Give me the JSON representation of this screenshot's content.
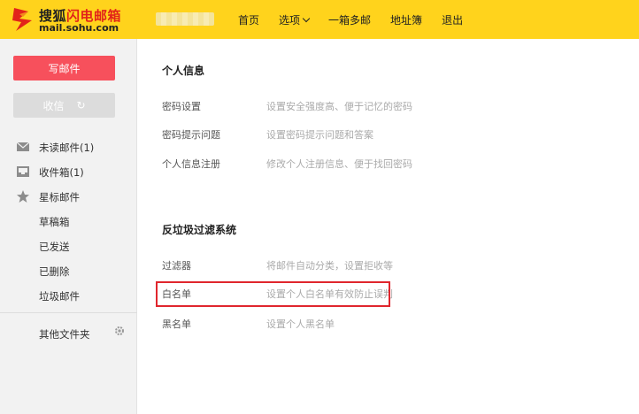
{
  "header": {
    "logo_title_prefix": "搜狐",
    "logo_title_suffix": "闪电邮箱",
    "logo_subtitle": "mail.sohu.com",
    "nav": [
      {
        "label": "首页"
      },
      {
        "label": "选项"
      },
      {
        "label": "一箱多邮"
      },
      {
        "label": "地址簿"
      },
      {
        "label": "退出"
      }
    ]
  },
  "sidebar": {
    "compose_label": "写邮件",
    "receive_label": "收信",
    "folders": [
      {
        "label": "未读邮件(1)",
        "icon": "mail-icon"
      },
      {
        "label": "收件箱(1)",
        "icon": "inbox-icon"
      },
      {
        "label": "星标邮件",
        "icon": "star-icon"
      },
      {
        "label": "草稿箱"
      },
      {
        "label": "已发送"
      },
      {
        "label": "已删除"
      },
      {
        "label": "垃圾邮件"
      }
    ],
    "other_folders_label": "其他文件夹"
  },
  "main": {
    "personal": {
      "title": "个人信息",
      "rows": [
        {
          "label": "密码设置",
          "desc": "设置安全强度高、便于记忆的密码"
        },
        {
          "label": "密码提示问题",
          "desc": "设置密码提示问题和答案"
        },
        {
          "label": "个人信息注册",
          "desc": "修改个人注册信息、便于找回密码"
        }
      ]
    },
    "spam": {
      "title": "反垃圾过滤系统",
      "rows": [
        {
          "label": "过滤器",
          "desc": "将邮件自动分类，设置拒收等"
        },
        {
          "label": "白名单",
          "desc": "设置个人白名单有效防止误判"
        },
        {
          "label": "黑名单",
          "desc": "设置个人黑名单"
        }
      ]
    }
  },
  "colors": {
    "header_bg": "#ffd31c",
    "compose_bg": "#f7505c",
    "highlight": "#e0262d"
  }
}
